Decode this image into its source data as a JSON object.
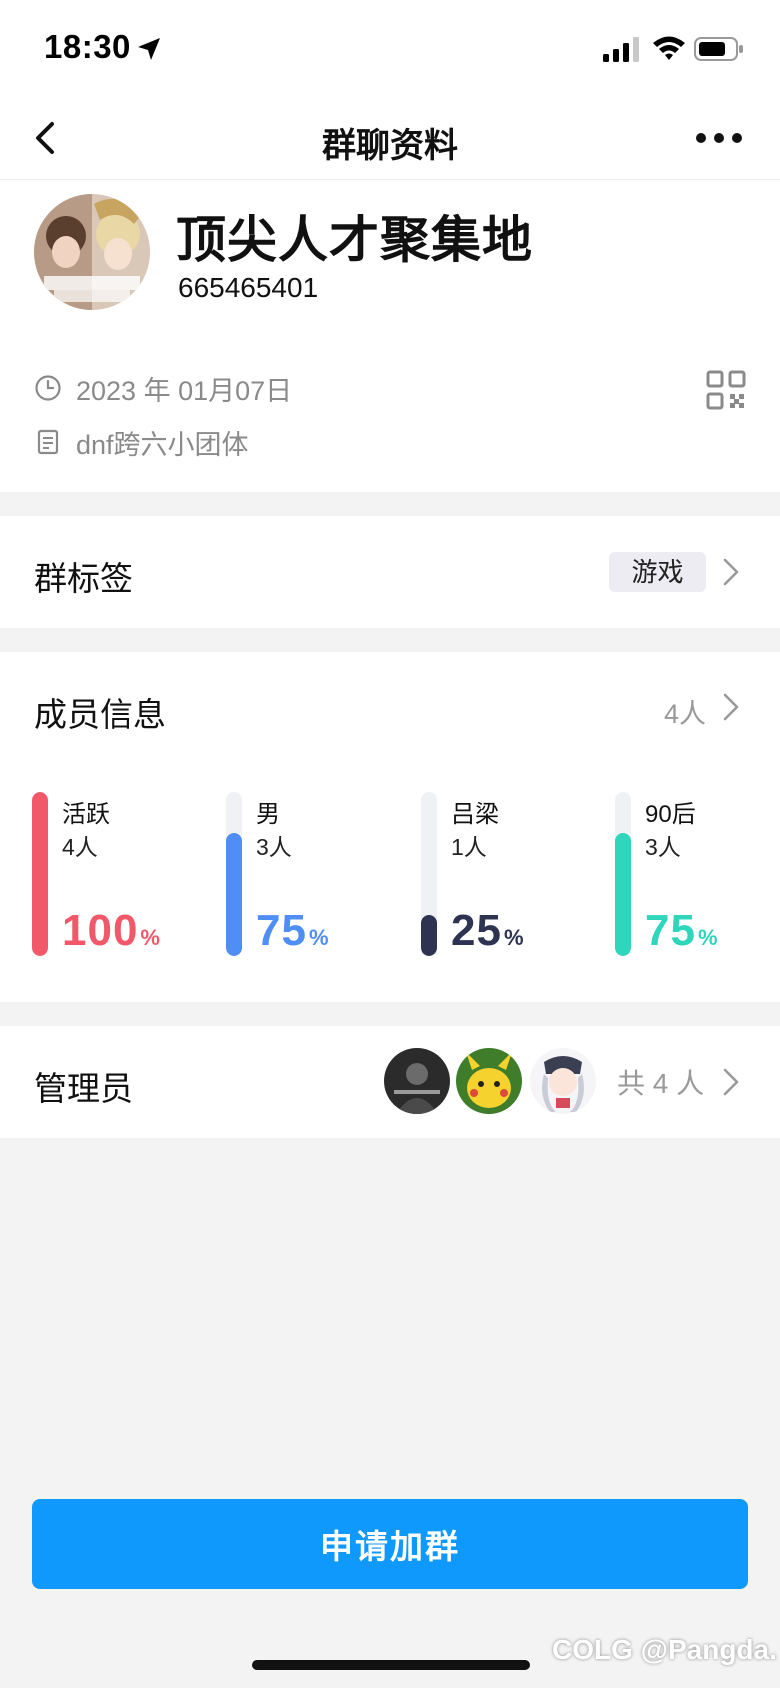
{
  "status_bar": {
    "time": "18:30"
  },
  "navbar": {
    "title": "群聊资料"
  },
  "group": {
    "name": "顶尖人才聚集地",
    "id": "665465401",
    "created_date": "2023 年 01月07日",
    "description": "dnf跨六小团体"
  },
  "tags_section": {
    "title": "群标签",
    "tag": "游戏"
  },
  "members_section": {
    "title": "成员信息",
    "count": "4人",
    "stats": [
      {
        "label": "活跃",
        "count": "4人",
        "percent": "100",
        "unit": "%",
        "value": 100,
        "color": "#f1596b"
      },
      {
        "label": "男",
        "count": "3人",
        "percent": "75",
        "unit": "%",
        "value": 75,
        "color": "#4f8ef5"
      },
      {
        "label": "吕梁",
        "count": "1人",
        "percent": "25",
        "unit": "%",
        "value": 25,
        "color": "#2e3352"
      },
      {
        "label": "90后",
        "count": "3人",
        "percent": "75",
        "unit": "%",
        "value": 75,
        "color": "#2fd6bc"
      }
    ]
  },
  "admin_section": {
    "title": "管理员",
    "total": "共 4 人"
  },
  "apply_button": {
    "label": "申请加群"
  },
  "watermark": "COLG @Pangda."
}
